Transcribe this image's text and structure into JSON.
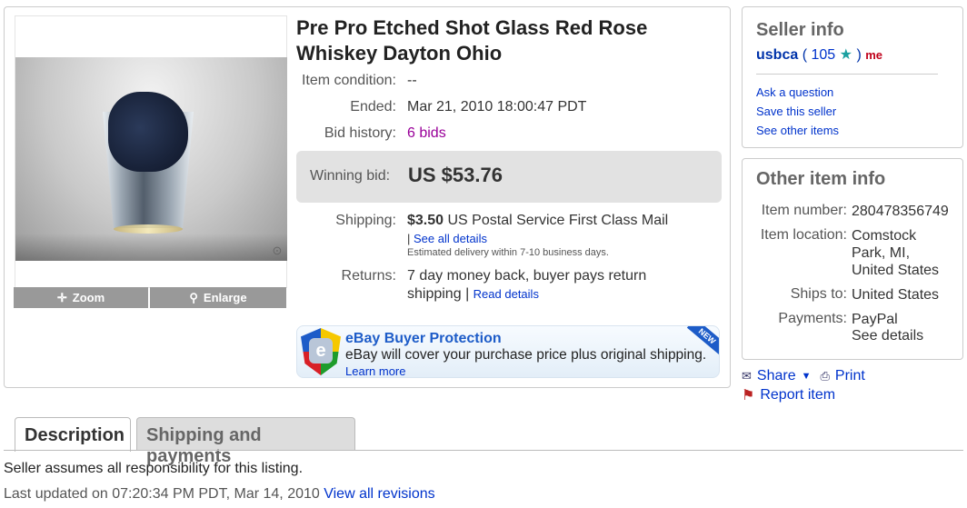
{
  "item": {
    "title": "Pre Pro Etched Shot Glass Red Rose Whiskey Dayton Ohio",
    "zoom_label": "Zoom",
    "enlarge_label": "Enlarge",
    "condition_label": "Item condition:",
    "condition_value": "--",
    "ended_label": "Ended:",
    "ended_value": "Mar 21, 2010 18:00:47 PDT",
    "bid_history_label": "Bid history:",
    "bid_history_value": "6 bids",
    "winning_bid_label": "Winning bid:",
    "winning_bid_value": "US $53.76",
    "shipping_label": "Shipping:",
    "shipping_price": "$3.50",
    "shipping_service": "US Postal Service First Class Mail",
    "shipping_see_all": "See all details",
    "shipping_estimate": "Estimated delivery within 7-10 business days.",
    "returns_label": "Returns:",
    "returns_line1": "7 day money back, buyer pays return",
    "returns_line2": "shipping",
    "returns_read_details": "Read details"
  },
  "buyer_protection": {
    "title": "eBay Buyer Protection",
    "text": "eBay will cover your purchase price plus original shipping.",
    "learn_more": "Learn more",
    "badge": "NEW",
    "shield_letter": "e"
  },
  "seller_info": {
    "heading": "Seller info",
    "name": "usbca",
    "feedback_open": "(",
    "feedback_score": "105",
    "feedback_close": ")",
    "me_badge": "me",
    "links": [
      "Ask a question",
      "Save this seller",
      "See other items"
    ]
  },
  "other_item_info": {
    "heading": "Other item info",
    "item_number_label": "Item number:",
    "item_number": "280478356749",
    "location_label": "Item location:",
    "location_lines": [
      "Comstock",
      "Park, MI,",
      "United States"
    ],
    "ships_to_label": "Ships to:",
    "ships_to": "United States",
    "payments_label": "Payments:",
    "payments": "PayPal",
    "payments_link": "See details"
  },
  "actions": {
    "share": "Share",
    "print": "Print",
    "report": "Report item"
  },
  "tabs": [
    "Description",
    "Shipping and payments"
  ],
  "description": {
    "text": "Seller assumes all responsibility for this listing.",
    "updated_prefix": "Last updated on 07:20:34 PM PDT, Mar 14, 2010",
    "revisions_link": "View all revisions"
  },
  "colors": {
    "link": "#0033cc",
    "bids": "#990099",
    "protection_blue": "#1d5cc8"
  }
}
